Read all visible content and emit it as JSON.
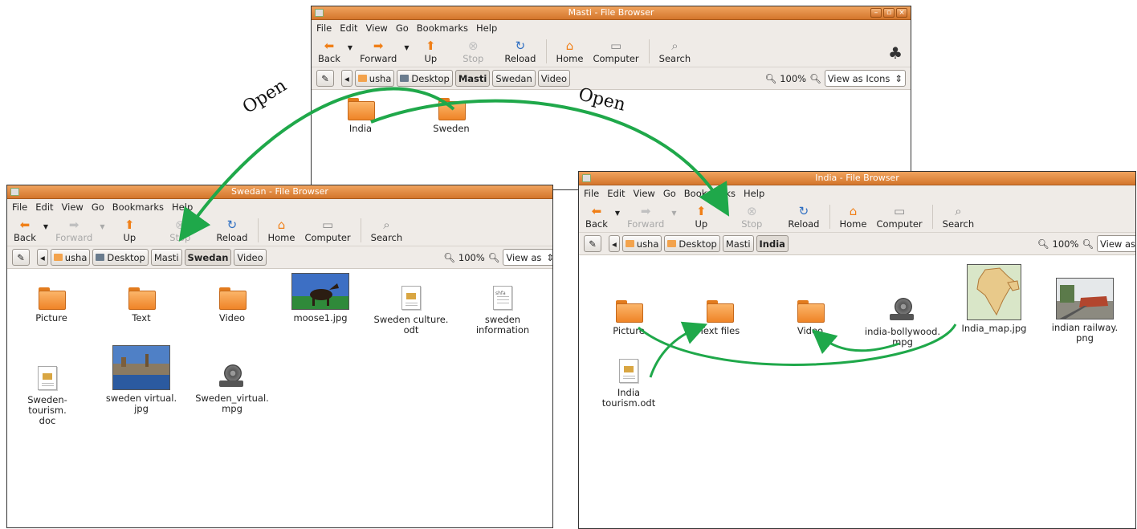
{
  "windows": {
    "masti": {
      "title": "Masti - File Browser",
      "menu": [
        "File",
        "Edit",
        "View",
        "Go",
        "Bookmarks",
        "Help"
      ],
      "toolbar": {
        "back": "Back",
        "forward": "Forward",
        "up": "Up",
        "stop": "Stop",
        "reload": "Reload",
        "home": "Home",
        "computer": "Computer",
        "search": "Search"
      },
      "path": [
        "usha",
        "Desktop",
        "Masti",
        "Swedan",
        "Video"
      ],
      "active_path": "Masti",
      "zoom": "100%",
      "view_as": "View as Icons",
      "items": [
        "India",
        "Sweden"
      ]
    },
    "swedan": {
      "title": "Swedan - File Browser",
      "menu": [
        "File",
        "Edit",
        "View",
        "Go",
        "Bookmarks",
        "Help"
      ],
      "toolbar": {
        "back": "Back",
        "forward": "Forward",
        "up": "Up",
        "stop": "Stop",
        "reload": "Reload",
        "home": "Home",
        "computer": "Computer",
        "search": "Search"
      },
      "path": [
        "usha",
        "Desktop",
        "Masti",
        "Swedan",
        "Video"
      ],
      "active_path": "Swedan",
      "zoom": "100%",
      "view_as": "View as",
      "items": [
        {
          "label": "Picture",
          "icon": "folder-icon"
        },
        {
          "label": "Text",
          "icon": "folder-icon"
        },
        {
          "label": "Video",
          "icon": "folder-icon"
        },
        {
          "label": "moose1.jpg",
          "icon": "image-thumbnail"
        },
        {
          "label": "Sweden culture.\nodt",
          "icon": "document-icon"
        },
        {
          "label": "sweden\ninformation",
          "icon": "text-file-icon",
          "tag": "shfa"
        },
        {
          "label": "Sweden-tourism.\ndoc",
          "icon": "document-icon"
        },
        {
          "label": "sweden virtual.\njpg",
          "icon": "image-thumbnail"
        },
        {
          "label": "Sweden_virtual.\nmpg",
          "icon": "film-reel-icon"
        }
      ]
    },
    "india": {
      "title": "India - File Browser",
      "menu": [
        "File",
        "Edit",
        "View",
        "Go",
        "Bookmarks",
        "Help"
      ],
      "toolbar": {
        "back": "Back",
        "forward": "Forward",
        "up": "Up",
        "stop": "Stop",
        "reload": "Reload",
        "home": "Home",
        "computer": "Computer",
        "search": "Search"
      },
      "path": [
        "usha",
        "Desktop",
        "Masti",
        "India"
      ],
      "active_path": "India",
      "zoom": "100%",
      "view_as": "View as",
      "items": [
        {
          "label": "Picture",
          "icon": "folder-icon"
        },
        {
          "label": "Text files",
          "icon": "folder-icon"
        },
        {
          "label": "Video",
          "icon": "folder-icon"
        },
        {
          "label": "india-bollywood.\nmpg",
          "icon": "film-reel-icon"
        },
        {
          "label": "India_map.jpg",
          "icon": "image-thumbnail"
        },
        {
          "label": "indian railway.\npng",
          "icon": "image-thumbnail"
        },
        {
          "label": "India tourism.odt",
          "icon": "document-icon"
        }
      ]
    }
  },
  "annotations": {
    "open_left": "Open",
    "open_right": "Open"
  },
  "colors": {
    "titlebar": "#e08a3c",
    "arrow": "#1fa84a",
    "folder": "#f39a3d"
  }
}
